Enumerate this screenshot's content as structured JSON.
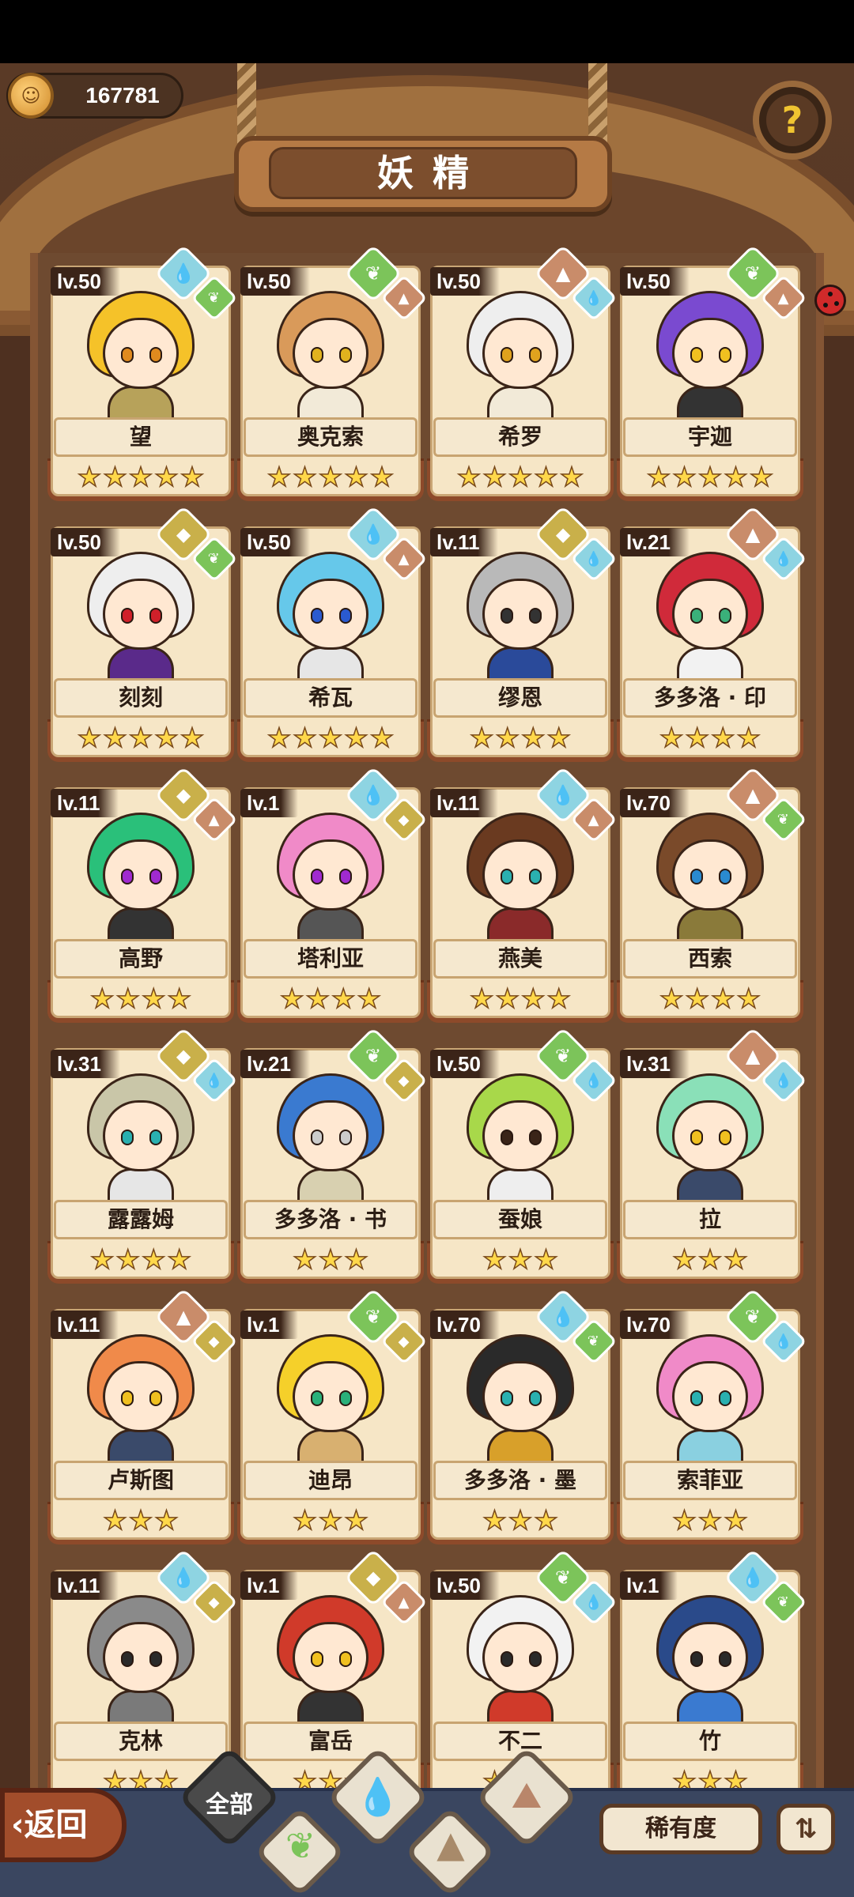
{
  "header": {
    "coins": "167781",
    "title": "妖精",
    "help_icon": "question-mark-sprout-icon"
  },
  "cards": [
    {
      "level": "lv.50",
      "name": "望",
      "stars": 5,
      "hair": "#f5c229",
      "eye": "#e08a1e",
      "body": "#b7a25a",
      "badges": [
        "#8ed4e2",
        "#7cc45a"
      ]
    },
    {
      "level": "lv.50",
      "name": "奥克索",
      "stars": 5,
      "hair": "#d99a5a",
      "eye": "#e0b21e",
      "body": "#f2ead8",
      "badges": [
        "#7cc45a",
        "#c98c6a"
      ]
    },
    {
      "level": "lv.50",
      "name": "希罗",
      "stars": 5,
      "hair": "#eeeeee",
      "eye": "#e0a21e",
      "body": "#f2ead8",
      "badges": [
        "#c98c6a",
        "#8ed4e2"
      ]
    },
    {
      "level": "lv.50",
      "name": "宇迦",
      "stars": 5,
      "hair": "#7a4ad0",
      "eye": "#f0c020",
      "body": "#333333",
      "badges": [
        "#7cc45a",
        "#c98c6a"
      ]
    },
    {
      "level": "lv.50",
      "name": "刻刻",
      "stars": 5,
      "hair": "#eeeeee",
      "eye": "#d0202a",
      "body": "#5a2a8a",
      "badges": [
        "#c9b04a",
        "#7cc45a"
      ]
    },
    {
      "level": "lv.50",
      "name": "希瓦",
      "stars": 5,
      "hair": "#66c8ea",
      "eye": "#2a5ad0",
      "body": "#e6e6e6",
      "badges": [
        "#8ed4e2",
        "#c98c6a"
      ]
    },
    {
      "level": "lv.11",
      "name": "缪恩",
      "stars": 4,
      "hair": "#b9b9b9",
      "eye": "#333333",
      "body": "#2a4a9a",
      "badges": [
        "#c9b04a",
        "#8ed4e2"
      ]
    },
    {
      "level": "lv.21",
      "name": "多多洛 · 印",
      "stars": 4,
      "hair": "#d02a3a",
      "eye": "#3ab07a",
      "body": "#f2f2f2",
      "badges": [
        "#c98c6a",
        "#8ed4e2"
      ]
    },
    {
      "level": "lv.11",
      "name": "高野",
      "stars": 4,
      "hair": "#2ac07a",
      "eye": "#a02ad0",
      "body": "#333333",
      "badges": [
        "#c9b04a",
        "#c98c6a"
      ]
    },
    {
      "level": "lv.1",
      "name": "塔利亚",
      "stars": 4,
      "hair": "#f08ac8",
      "eye": "#a02ad0",
      "body": "#555555",
      "badges": [
        "#8ed4e2",
        "#c9b04a"
      ]
    },
    {
      "level": "lv.11",
      "name": "燕美",
      "stars": 4,
      "hair": "#6a3a20",
      "eye": "#2ab0b0",
      "body": "#8a2a2a",
      "badges": [
        "#8ed4e2",
        "#c98c6a"
      ]
    },
    {
      "level": "lv.70",
      "name": "西索",
      "stars": 4,
      "hair": "#7a4a2a",
      "eye": "#2a8ad0",
      "body": "#8a7a3a",
      "badges": [
        "#c98c6a",
        "#7cc45a"
      ]
    },
    {
      "level": "lv.31",
      "name": "露露姆",
      "stars": 4,
      "hair": "#c9c6a8",
      "eye": "#2ab0b0",
      "body": "#e6e6e6",
      "badges": [
        "#c9b04a",
        "#8ed4e2"
      ]
    },
    {
      "level": "lv.21",
      "name": "多多洛 · 书",
      "stars": 3,
      "hair": "#3a7ad0",
      "eye": "#cccccc",
      "body": "#d8d0b0",
      "badges": [
        "#7cc45a",
        "#c9b04a"
      ]
    },
    {
      "level": "lv.50",
      "name": "蚕娘",
      "stars": 3,
      "hair": "#a8d84a",
      "eye": "#3a2418",
      "body": "#eeeeee",
      "badges": [
        "#7cc45a",
        "#8ed4e2"
      ]
    },
    {
      "level": "lv.31",
      "name": "拉",
      "stars": 3,
      "hair": "#8ae0b8",
      "eye": "#f0c020",
      "body": "#3a4a6a",
      "badges": [
        "#c98c6a",
        "#8ed4e2"
      ]
    },
    {
      "level": "lv.11",
      "name": "卢斯图",
      "stars": 3,
      "hair": "#f08a4a",
      "eye": "#f0c020",
      "body": "#3a4a6a",
      "badges": [
        "#c98c6a",
        "#c9b04a"
      ]
    },
    {
      "level": "lv.1",
      "name": "迪昂",
      "stars": 3,
      "hair": "#f5d02a",
      "eye": "#2ab07a",
      "body": "#d8b070",
      "badges": [
        "#7cc45a",
        "#c9b04a"
      ]
    },
    {
      "level": "lv.70",
      "name": "多多洛 · 墨",
      "stars": 3,
      "hair": "#2a2a2a",
      "eye": "#2ab0b0",
      "body": "#d8a02a",
      "badges": [
        "#8ed4e2",
        "#7cc45a"
      ]
    },
    {
      "level": "lv.70",
      "name": "索菲亚",
      "stars": 3,
      "hair": "#f08ac8",
      "eye": "#2ab0b0",
      "body": "#8ad0e0",
      "badges": [
        "#7cc45a",
        "#8ed4e2"
      ]
    },
    {
      "level": "lv.11",
      "name": "克林",
      "stars": 3,
      "hair": "#8a8a8a",
      "eye": "#2a2a2a",
      "body": "#7a7a7a",
      "badges": [
        "#8ed4e2",
        "#c9b04a"
      ]
    },
    {
      "level": "lv.1",
      "name": "富岳",
      "stars": 3,
      "hair": "#d03a2a",
      "eye": "#f0c020",
      "body": "#333333",
      "badges": [
        "#c9b04a",
        "#c98c6a"
      ]
    },
    {
      "level": "lv.50",
      "name": "不二",
      "stars": 3,
      "hair": "#f2f2f2",
      "eye": "#2a2a2a",
      "body": "#d03a2a",
      "badges": [
        "#7cc45a",
        "#8ed4e2"
      ]
    },
    {
      "level": "lv.1",
      "name": "竹",
      "stars": 3,
      "hair": "#2a4a8a",
      "eye": "#2a2a2a",
      "body": "#3a7ad0",
      "badges": [
        "#8ed4e2",
        "#7cc45a"
      ]
    }
  ],
  "bottom": {
    "back_label": "返回",
    "tabs": [
      "全部"
    ],
    "tab_icons": [
      "sprout-icon",
      "droplet-icon",
      "mountain-icon",
      "peak-icon"
    ],
    "sort_label": "稀有度",
    "order_icon": "sort-order-icon"
  },
  "colors": {
    "wood": "#6e4a30",
    "card": "#f6e6c6",
    "card_base": "#8d4a2a",
    "star": "#ffd84a",
    "bottom_bar": "#3a4660"
  }
}
